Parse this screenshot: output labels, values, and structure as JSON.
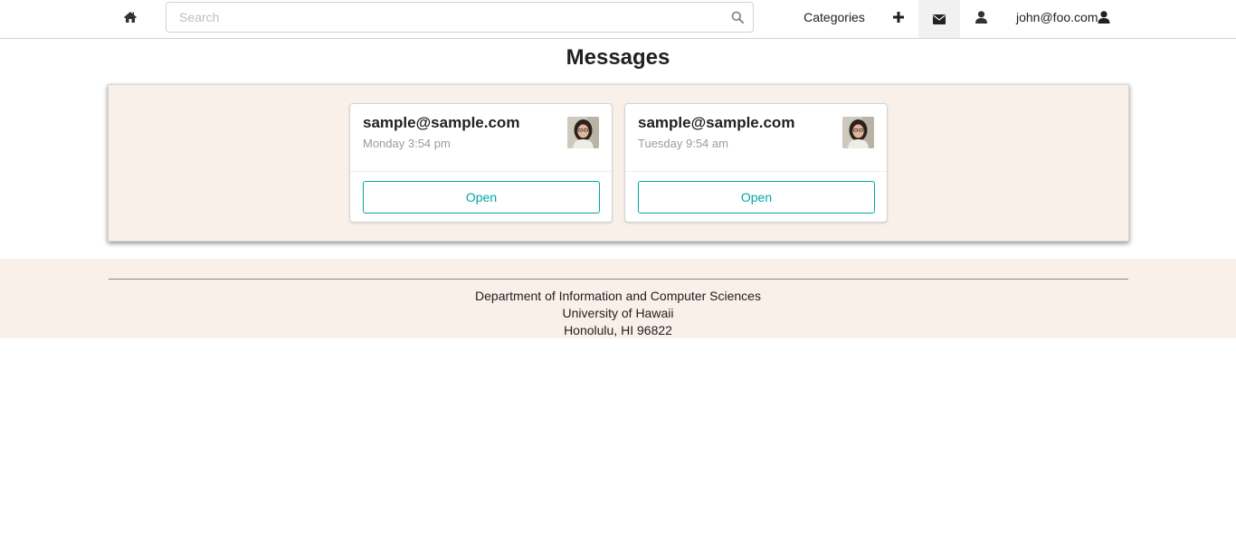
{
  "nav": {
    "search_placeholder": "Search",
    "categories_label": "Categories",
    "user_label": "john@foo.com",
    "icons": {
      "home": "home-icon",
      "search": "search-icon",
      "add": "plus-icon",
      "mail": "envelope-icon",
      "profile": "user-icon",
      "user": "user-icon"
    }
  },
  "page": {
    "title": "Messages"
  },
  "messages": [
    {
      "email": "sample@sample.com",
      "time": "Monday 3:54 pm",
      "open_label": "Open"
    },
    {
      "email": "sample@sample.com",
      "time": "Tuesday 9:54 am",
      "open_label": "Open"
    }
  ],
  "footer": {
    "line1": "Department of Information and Computer Sciences",
    "line2": "University of Hawaii",
    "line3": "Honolulu, HI 96822"
  },
  "colors": {
    "accent": "#00a6a6",
    "panel_bg": "#faf0ea",
    "active_nav_bg": "#f1f1f1"
  }
}
